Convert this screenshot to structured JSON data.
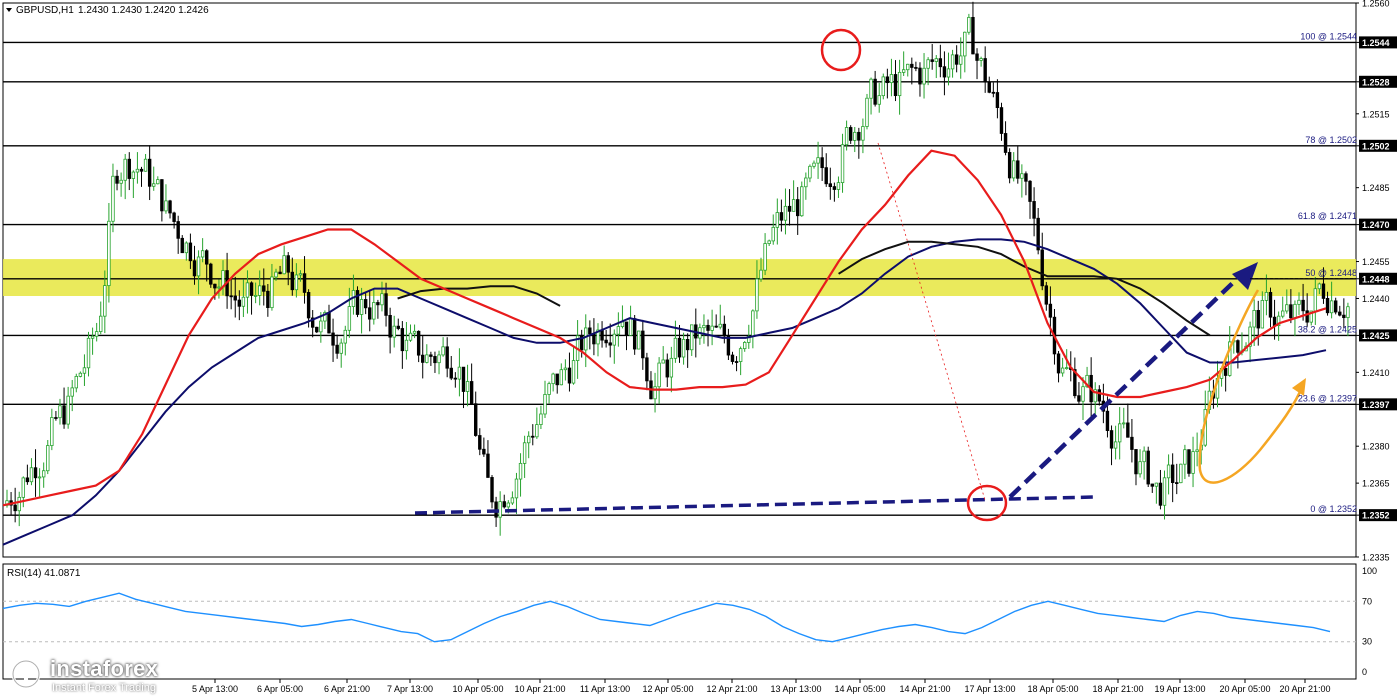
{
  "header": {
    "symbol_timeframe": "GBPUSD,H1",
    "ohlc": "1.2430 1.2430 1.2420 1.2426"
  },
  "rsi": {
    "label": "RSI(14) 41.0871",
    "levels": [
      100,
      70,
      30,
      0
    ],
    "color": "#1e90ff"
  },
  "logo": {
    "name": "instaforex",
    "tagline": "Instant Forex Trading"
  },
  "colors": {
    "zone": "#e8e84a",
    "ma_fast": "#e81c1c",
    "ma_mid": "#0d0d6b",
    "ma_slow": "#111111",
    "arrow": "#1a1a80",
    "orange": "#f5a623",
    "rsi": "#1e90ff"
  },
  "chart_data": {
    "type": "candlestick",
    "ylim": [
      1.2335,
      1.256
    ],
    "y_ticks": [
      1.256,
      1.2544,
      1.2528,
      1.2515,
      1.2502,
      1.2485,
      1.247,
      1.2455,
      1.2448,
      1.244,
      1.2425,
      1.241,
      1.2397,
      1.238,
      1.2365,
      1.2352,
      1.2335
    ],
    "x_ticks": [
      "5 Apr 13:00",
      "6 Apr 05:00",
      "6 Apr 21:00",
      "7 Apr 13:00",
      "10 Apr 05:00",
      "10 Apr 21:00",
      "11 Apr 13:00",
      "12 Apr 05:00",
      "12 Apr 21:00",
      "13 Apr 13:00",
      "14 Apr 05:00",
      "14 Apr 21:00",
      "17 Apr 13:00",
      "18 Apr 05:00",
      "18 Apr 21:00",
      "19 Apr 13:00",
      "20 Apr 05:00",
      "20 Apr 21:00"
    ],
    "price_levels": [
      1.2544,
      1.2528,
      1.2502,
      1.247,
      1.2448,
      1.2425,
      1.2397,
      1.2352
    ],
    "fib_levels": [
      {
        "label": "100 @ 1.2544",
        "value": 1.2544
      },
      {
        "label": "78 @ 1.2502",
        "value": 1.2502
      },
      {
        "label": "61.8 @ 1.2471",
        "value": 1.2471
      },
      {
        "label": "50 @ 1.2448",
        "value": 1.2448
      },
      {
        "label": "38.2 @ 1.2425",
        "value": 1.2425
      },
      {
        "label": "23.6 @ 1.2397",
        "value": 1.2397
      },
      {
        "label": "0 @ 1.2352",
        "value": 1.2352
      }
    ],
    "zone": [
      1.2441,
      1.2456
    ],
    "ma_fast": [
      1.2356,
      1.2358,
      1.236,
      1.2362,
      1.2364,
      1.237,
      1.2385,
      1.2405,
      1.2425,
      1.244,
      1.245,
      1.2458,
      1.2462,
      1.2465,
      1.2468,
      1.2468,
      1.2462,
      1.2455,
      1.2448,
      1.2444,
      1.244,
      1.2436,
      1.2432,
      1.2428,
      1.2424,
      1.2418,
      1.241,
      1.2404,
      1.2403,
      1.2403,
      1.2404,
      1.2404,
      1.2405,
      1.241,
      1.2425,
      1.244,
      1.2455,
      1.2468,
      1.2478,
      1.249,
      1.25,
      1.2498,
      1.2488,
      1.2474,
      1.2455,
      1.243,
      1.2412,
      1.2402,
      1.24,
      1.24,
      1.2402,
      1.2404,
      1.2407,
      1.2415,
      1.2424,
      1.243,
      1.2433,
      1.2436
    ],
    "ma_mid": [
      1.234,
      1.2344,
      1.2348,
      1.2352,
      1.236,
      1.237,
      1.2382,
      1.2394,
      1.2404,
      1.2412,
      1.2418,
      1.2424,
      1.2427,
      1.243,
      1.2434,
      1.244,
      1.2444,
      1.2444,
      1.244,
      1.2436,
      1.2432,
      1.2428,
      1.2424,
      1.2422,
      1.2422,
      1.2424,
      1.2428,
      1.2432,
      1.243,
      1.2428,
      1.2426,
      1.2424,
      1.2424,
      1.2426,
      1.2428,
      1.2432,
      1.2436,
      1.2442,
      1.245,
      1.2457,
      1.2461,
      1.2463,
      1.2464,
      1.2464,
      1.2463,
      1.246,
      1.2456,
      1.2452,
      1.2446,
      1.2438,
      1.2428,
      1.2418,
      1.2414,
      1.2414,
      1.2415,
      1.2416,
      1.2417,
      1.2419
    ],
    "ma_slow": [
      null,
      null,
      null,
      null,
      null,
      null,
      null,
      null,
      null,
      null,
      null,
      null,
      null,
      null,
      null,
      null,
      null,
      1.244,
      1.2443,
      1.2444,
      1.2444,
      1.2445,
      1.2445,
      1.2442,
      1.2437,
      null,
      null,
      null,
      null,
      null,
      null,
      null,
      null,
      null,
      null,
      null,
      1.245,
      1.2456,
      1.246,
      1.2463,
      1.2463,
      1.2462,
      1.2461,
      1.2458,
      1.2453,
      1.2449,
      1.2449,
      1.2449,
      1.2448,
      1.2444,
      1.2438,
      1.2431,
      1.2425,
      null,
      null,
      null,
      null,
      null
    ],
    "rsi_values": [
      63,
      66,
      68,
      67,
      65,
      70,
      74,
      78,
      72,
      68,
      64,
      60,
      58,
      56,
      54,
      52,
      50,
      48,
      45,
      47,
      50,
      52,
      48,
      44,
      40,
      38,
      30,
      32,
      40,
      48,
      55,
      60,
      66,
      70,
      65,
      58,
      52,
      50,
      48,
      46,
      52,
      58,
      63,
      68,
      66,
      62,
      55,
      45,
      38,
      32,
      30,
      34,
      38,
      42,
      45,
      47,
      44,
      40,
      38,
      44,
      52,
      60,
      66,
      70,
      66,
      62,
      58,
      56,
      54,
      52,
      50,
      56,
      60,
      58,
      54,
      52,
      50,
      48,
      46,
      44,
      40
    ]
  }
}
